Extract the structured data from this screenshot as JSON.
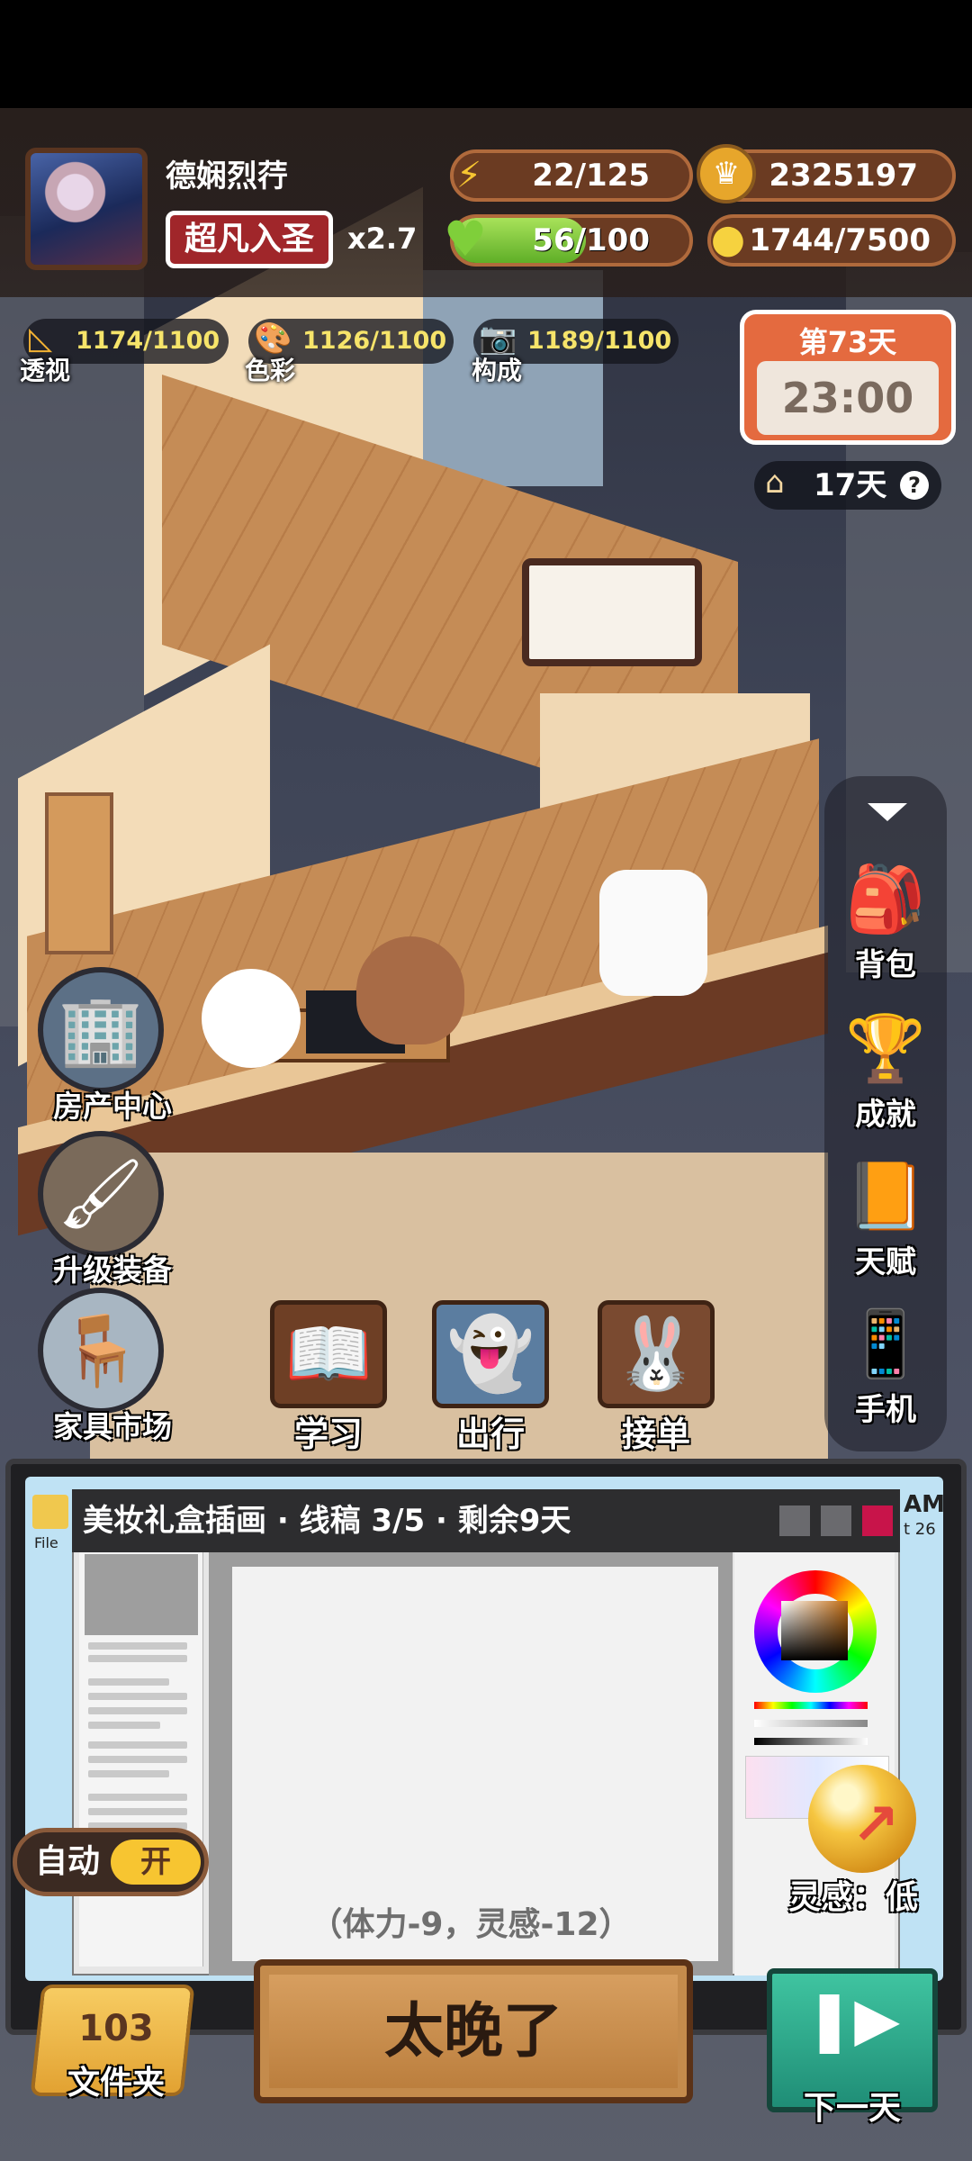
{
  "player": {
    "name": "德娴烈荇",
    "rank": "超凡入圣",
    "multiplier": "x2.7"
  },
  "stats": {
    "energy": "22/125",
    "coins": "2325197",
    "health": "56/100",
    "health_fraction": 0.56,
    "inspiration_points": "1744/7500"
  },
  "skills": [
    {
      "label": "透视",
      "value": "1174/1100",
      "icon": "ruler-icon"
    },
    {
      "label": "色彩",
      "value": "1126/1100",
      "icon": "palette-icon"
    },
    {
      "label": "构成",
      "value": "1189/1100",
      "icon": "camera-icon"
    }
  ],
  "day": {
    "title": "第73天",
    "clock": "23:00",
    "rent": "17天",
    "help": "?"
  },
  "side_menu": [
    {
      "label": "背包",
      "icon": "backpack-icon"
    },
    {
      "label": "成就",
      "icon": "trophy-icon"
    },
    {
      "label": "天赋",
      "icon": "book-icon"
    },
    {
      "label": "手机",
      "icon": "phone-icon"
    }
  ],
  "left_menu": [
    {
      "label": "房产中心",
      "icon": "building-icon"
    },
    {
      "label": "升级装备",
      "icon": "tools-icon"
    },
    {
      "label": "家具市场",
      "icon": "furniture-icon"
    }
  ],
  "actions": [
    {
      "label": "学习",
      "icon": "book-quill-icon"
    },
    {
      "label": "出行",
      "icon": "ghost-icon"
    },
    {
      "label": "接单",
      "icon": "rabbit-icon"
    }
  ],
  "work": {
    "title": "美妆礼盒插画 · 线稿 3/5 · 剩余9天",
    "cost": "（体力-9，灵感-12）",
    "file_label": "File",
    "clock_fragment": "AM",
    "date_fragment": "t 26"
  },
  "auto": {
    "label": "自动",
    "state": "开"
  },
  "inspiration": {
    "label": "灵感：低"
  },
  "folder": {
    "count": "103",
    "label": "文件夹"
  },
  "main_button": {
    "label": "太晚了"
  },
  "next_day": {
    "label": "下一天"
  },
  "colors": {
    "accent_red": "#a0262a",
    "energy_yellow": "#f7c531",
    "health_green": "#5fae27",
    "day_orange": "#e46a3f",
    "next_green": "#1f8d76"
  }
}
